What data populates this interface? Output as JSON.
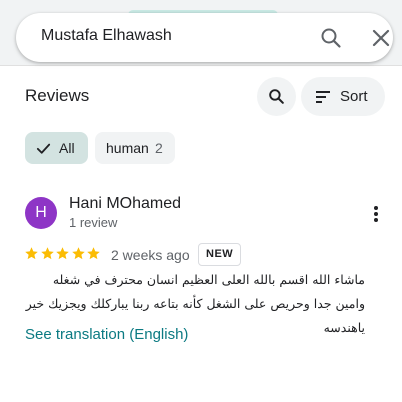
{
  "search": {
    "value": "Mustafa Elhawash"
  },
  "reviews": {
    "title": "Reviews",
    "sort_label": "Sort"
  },
  "filters": [
    {
      "label": "All",
      "selected": true
    },
    {
      "label": "human",
      "count": "2",
      "selected": false
    }
  ],
  "review": {
    "avatar_letter": "H",
    "avatar_color": "#8e35c6",
    "author": "Hani MOhamed",
    "author_meta": "1 review",
    "rating": 5,
    "date": "2 weeks ago",
    "badge": "NEW",
    "text": "ماشاء الله اقسم بالله العلى العظيم انسان محترف في شغله وامين جدا وحريص على الشغل كأنه بتاعه ربنا يباركلك ويجزيك خير ياهندسه",
    "translate_link": "See translation (English)"
  },
  "colors": {
    "star": "#fbbc04",
    "link": "#0b7a82",
    "chip_selected": "#d3e3e1"
  }
}
